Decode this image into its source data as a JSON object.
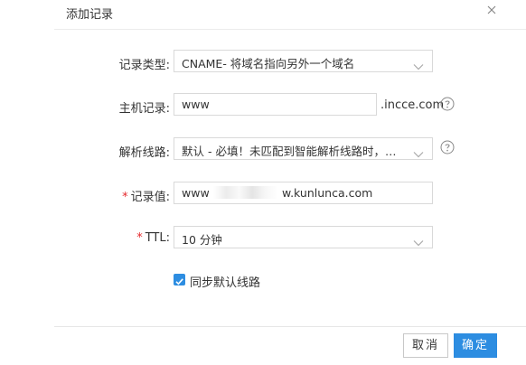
{
  "dialog": {
    "title": "添加记录",
    "close_icon": "close-icon"
  },
  "form": {
    "record_type": {
      "label": "记录类型:",
      "value": "CNAME- 将域名指向另外一个域名"
    },
    "host": {
      "label": "主机记录:",
      "value": "www",
      "suffix": ".incce.com",
      "help_icon": "question-circle-icon"
    },
    "line": {
      "label": "解析线路:",
      "value": "默认 - 必填！未匹配到智能解析线路时，返回...",
      "help_icon": "question-circle-icon"
    },
    "record_value": {
      "required_mark": "*",
      "label": "记录值:",
      "value": "www ",
      "value_tail": "w.kunlunca.com"
    },
    "ttl": {
      "required_mark": "*",
      "label": "TTL:",
      "value": "10 分钟"
    },
    "sync_default": {
      "label": "同步默认线路",
      "checked": true
    }
  },
  "footer": {
    "cancel_label": "取消",
    "confirm_label": "确定"
  },
  "colors": {
    "primary": "#2d8de1",
    "required": "#e5282c",
    "border": "#d9d9d9"
  }
}
